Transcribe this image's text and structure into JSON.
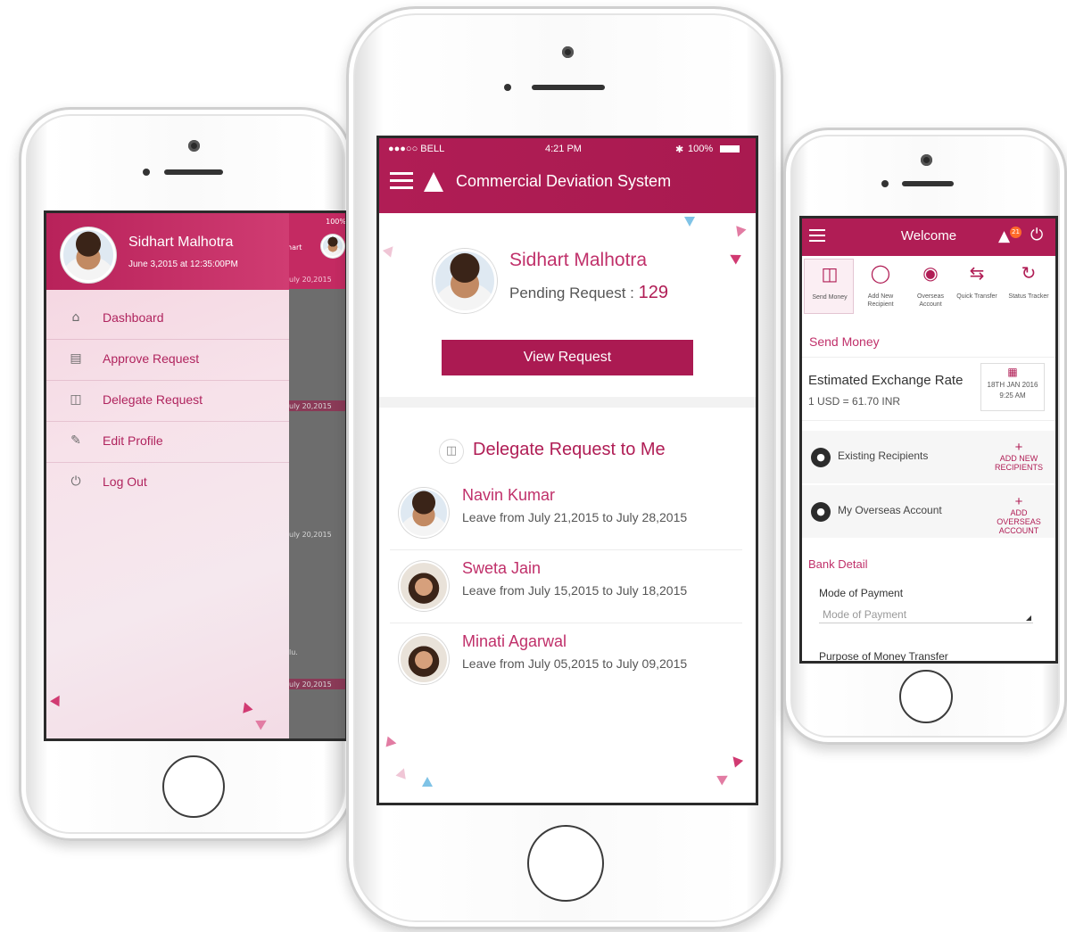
{
  "left_phone": {
    "status_battery": "100%",
    "background_labels": [
      "hart",
      "uly 20,2015",
      "uly 20,2015",
      "uly 20,2015",
      "lu.",
      "uly 20,2015"
    ],
    "drawer": {
      "user_name": "Sidhart Malhotra",
      "user_date": "June 3,2015 at 12:35:00PM",
      "items": [
        {
          "label": "Dashboard",
          "icon": "home-icon"
        },
        {
          "label": "Approve Request",
          "icon": "document-icon"
        },
        {
          "label": "Delegate Request",
          "icon": "delegate-doc-icon"
        },
        {
          "label": "Edit Profile",
          "icon": "edit-profile-icon"
        },
        {
          "label": "Log Out",
          "icon": "power-icon"
        }
      ]
    }
  },
  "center_phone": {
    "status": {
      "carrier": "●●●○○ BELL",
      "time": "4:21 PM",
      "battery": "100%"
    },
    "header": {
      "title": "Commercial Deviation System"
    },
    "profile": {
      "name": "Sidhart Malhotra",
      "pending_label": "Pending Request :",
      "pending_count": "129"
    },
    "view_button": "View Request",
    "delegate_section": {
      "title": "Delegate Request to Me"
    },
    "requests": [
      {
        "name": "Navin Kumar",
        "leave": "Leave from July 21,2015 to July 28,2015"
      },
      {
        "name": "Sweta Jain",
        "leave": "Leave from July 15,2015 to July 18,2015"
      },
      {
        "name": "Minati Agarwal",
        "leave": "Leave from July 05,2015 to July 09,2015"
      }
    ]
  },
  "right_phone": {
    "header": {
      "title": "Welcome",
      "notification_count": "21"
    },
    "quick_actions": [
      {
        "label": "Send Money",
        "icon": "coins-icon"
      },
      {
        "label": "Add New Recipient",
        "icon": "add-user-icon"
      },
      {
        "label": "Overseas Account",
        "icon": "piggy-bank-icon"
      },
      {
        "label": "Quick Transfer",
        "icon": "transfer-icon"
      },
      {
        "label": "Status Tracker",
        "icon": "tracker-icon"
      }
    ],
    "section_title": "Send Money",
    "exchange": {
      "title": "Estimated Exchange Rate",
      "value": "1 USD = 61.70 INR",
      "date": "18TH JAN 2016",
      "time": "9:25 AM"
    },
    "rows": [
      {
        "label": "Existing Recipients",
        "action": "ADD NEW RECIPIENTS"
      },
      {
        "label": "My Overseas Account",
        "action": "ADD OVERSEAS ACCOUNT"
      }
    ],
    "bank_detail": "Bank Detail",
    "mode_label": "Mode of Payment",
    "mode_placeholder": "Mode of Payment",
    "purpose_label": "Purpose of Money Transfer"
  },
  "colors": {
    "brand": "#b01d55",
    "accent_pink": "#c0306a",
    "drawer_bg": "#f5e2ea"
  }
}
